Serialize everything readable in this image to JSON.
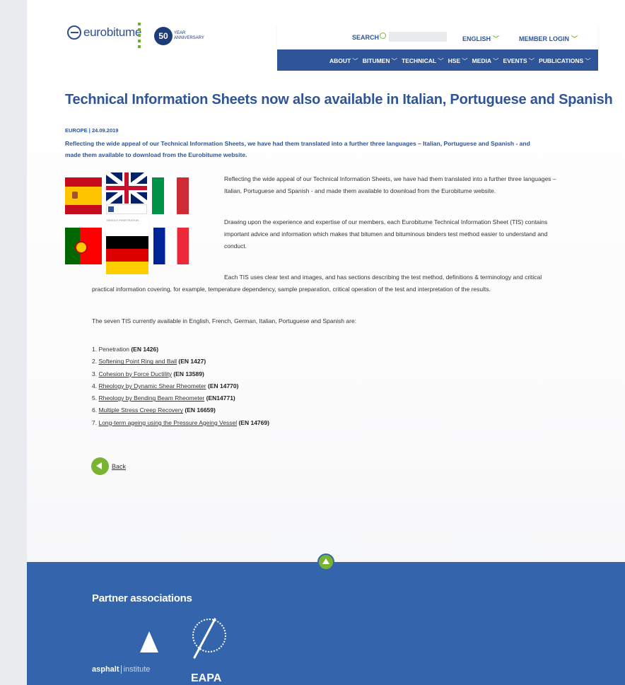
{
  "header": {
    "logo_text": "eurobitume",
    "anniversary_number": "50",
    "anniversary_text": [
      "YEAR",
      "ANNIVERSARY"
    ],
    "search_label": "SEARCH",
    "search_placeholder": "",
    "language": "ENGLISH",
    "member_login": "MEMBER LOGIN"
  },
  "nav": {
    "items": [
      {
        "label": "ABOUT"
      },
      {
        "label": "BITUMEN"
      },
      {
        "label": "TECHNICAL"
      },
      {
        "label": "HSE"
      },
      {
        "label": "MEDIA"
      },
      {
        "label": "EVENTS"
      },
      {
        "label": "PUBLICATIONS"
      }
    ]
  },
  "article": {
    "title": "Technical Information Sheets now also available in Italian, Portuguese and Spanish",
    "meta": "EUROPE | 24.09.2019",
    "lead": "Reflecting the wide appeal of our Technical Information Sheets, we have had them translated into a further three languages – Italian, Portuguese and Spanish - and made them available to download from the Eurobitume website.",
    "p1": "Reflecting the wide appeal of our Technical Information Sheets, we have had them translated into a further three languages – Italian, Portuguese and Spanish - and made them available to download from the Eurobitume website.",
    "p2": "Drawing upon the experience and expertise of our members, each Eurobitume Technical Information Sheet (TIS) contains important advice and information which makes that bitumen and bituminous binders test method easier to understand and conduct.",
    "p3a": "Each TIS uses clear text and images, and has sections describing the test method, definitions & terminology and critical",
    "p3b": "practical information covering, for example, temperature dependency, sample preparation, critical operation of the test and interpretation of the results.",
    "p4": "The seven TIS currently available in English, French, German, Italian, Portuguese and Spanish are:",
    "doc_thumb_text": "NEEDLE PENETRATION",
    "tis_list": [
      {
        "num": "1.",
        "name": "Penetration",
        "code": "(EN 1426)",
        "link": false
      },
      {
        "num": "2.",
        "name": "Softening Point Ring and Ball",
        "code": "(EN 1427)",
        "link": true
      },
      {
        "num": "3.",
        "name": "Cohesion by Force Ductility",
        "code": "(EN 13589)",
        "link": true
      },
      {
        "num": "4.",
        "name": "Rheology by Dynamic Shear Rheometer",
        "code": "(EN 14770)",
        "link": true
      },
      {
        "num": "5.",
        "name": "Rheology by Bending Beam Rheometer",
        "code": "(EN14771)",
        "link": true
      },
      {
        "num": "6.",
        "name": "Multiple Stress Creep Recovery",
        "code": "(EN 16659)",
        "link": true
      },
      {
        "num": "7.",
        "name": "Long-term ageing using the Pressure Ageing Vessel",
        "code": "(EN 14769)",
        "link": true
      }
    ],
    "back_label": "Back"
  },
  "footer": {
    "partners_title": "Partner associations",
    "asphalt_bold": "asphalt",
    "asphalt_light": "institute",
    "eapa_text": "EAPA"
  },
  "colors": {
    "brand_blue": "#2f5598",
    "accent_green": "#79b332",
    "footer_blue": "#3464ab"
  }
}
